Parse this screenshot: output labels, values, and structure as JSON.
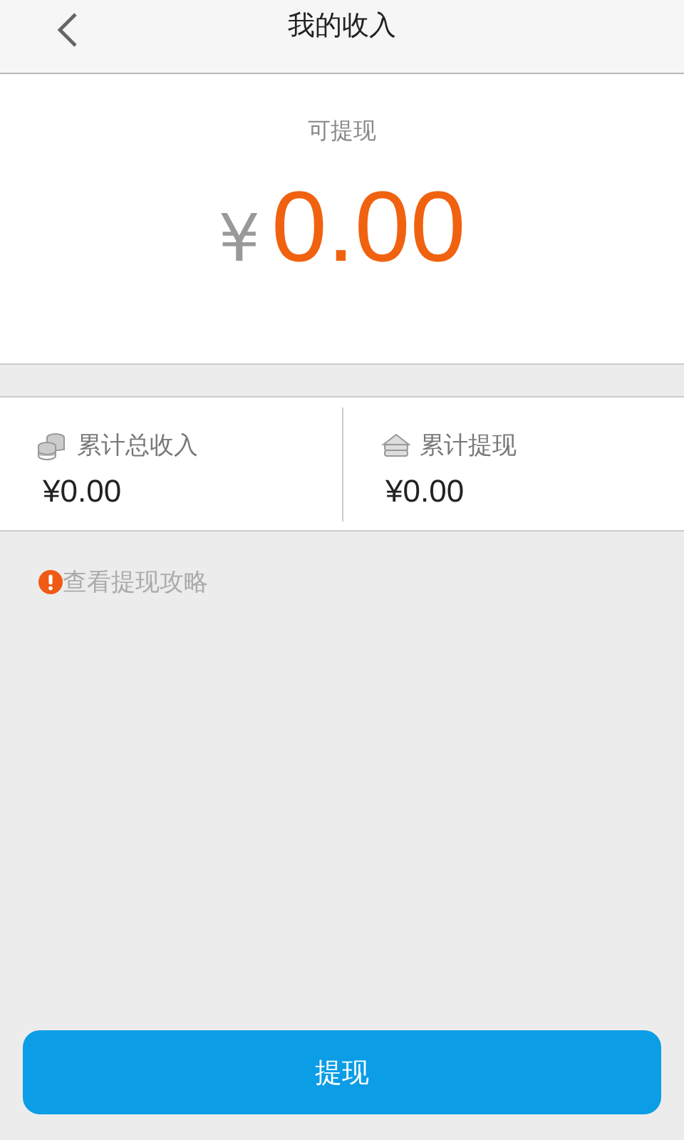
{
  "header": {
    "title": "我的收入"
  },
  "balance": {
    "label": "可提现",
    "currency": "¥",
    "amount": "0.00"
  },
  "stats": [
    {
      "kind": "coins",
      "label": "累计总收入",
      "value": "¥0.00"
    },
    {
      "kind": "stack",
      "label": "累计提现",
      "value": "¥0.00"
    }
  ],
  "tip": {
    "text": "查看提现攻略"
  },
  "withdraw_button": {
    "label": "提现"
  }
}
